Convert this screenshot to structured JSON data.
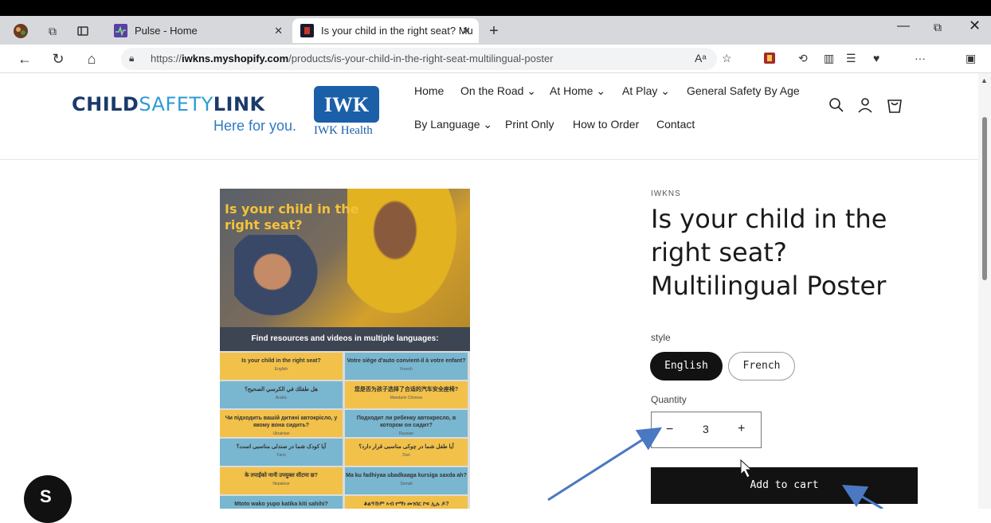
{
  "browser": {
    "tabs": [
      {
        "label": "Pulse - Home",
        "active": false
      },
      {
        "label": "Is your child in the right seat? Mu",
        "active": true
      }
    ],
    "url_prefix": "https://",
    "url_domain": "iwkns.myshopify.com",
    "url_path": "/products/is-your-child-in-the-right-seat-multilingual-poster",
    "new_tab": "+",
    "tab_close": "✕",
    "win_min": "—",
    "win_restore": "⧉",
    "win_close": "✕",
    "reader_label": "Aᵃ",
    "more_label": "···"
  },
  "site": {
    "logo_child": "CHILD",
    "logo_safety": "SAFETY",
    "logo_link": "LINK",
    "logo_tagline": "Here for you.",
    "logo_partner": "IWK Health",
    "nav": [
      {
        "label": "Home"
      },
      {
        "label": "On the Road ⌄"
      },
      {
        "label": "At Home ⌄"
      },
      {
        "label": "At Play ⌄"
      },
      {
        "label": "General Safety By Age"
      },
      {
        "label": "By Language ⌄"
      },
      {
        "label": "Print Only"
      },
      {
        "label": "How to Order"
      },
      {
        "label": "Contact"
      }
    ],
    "icons": [
      "search-icon",
      "account-icon",
      "cart-icon"
    ]
  },
  "poster": {
    "title": "Is your child in the right seat?",
    "band": "Find resources and videos in multiple languages:",
    "cells": [
      {
        "text": "Is your child in the right seat?",
        "sub": "English",
        "color": "y"
      },
      {
        "text": "Votre siège d'auto convient-il à votre enfant?",
        "sub": "French",
        "color": "b"
      },
      {
        "text": "هل طفلك في الكرسي الصحيح؟",
        "sub": "Arabic",
        "color": "b"
      },
      {
        "text": "您是否为孩子选择了合适的汽车安全座椅?",
        "sub": "Mandarin Chinese",
        "color": "y"
      },
      {
        "text": "Чи підходить вашій дитині автокрісло, у якому вона сидить?",
        "sub": "Ukrainian",
        "color": "y"
      },
      {
        "text": "Подходит ли ребенку автокресло, в котором он сидит?",
        "sub": "Russian",
        "color": "b"
      },
      {
        "text": "آیا کودک شما در صندلی مناسبی است؟",
        "sub": "Farsi",
        "color": "b"
      },
      {
        "text": "آیا طفل شما در چوکی مناسبی قرار دارد؟",
        "sub": "Dari",
        "color": "y"
      },
      {
        "text": "के तपाईंको नानी उपयुक्त सीटमा छ?",
        "sub": "Nepalese",
        "color": "y"
      },
      {
        "text": "Ma ku fadhiyaa ubadkaaga kursiga saxda ah?",
        "sub": "Somali",
        "color": "b"
      },
      {
        "text": "Mtoto wako yupo katika kiti sahihi?",
        "sub": "",
        "color": "b"
      },
      {
        "text": "ቆልዓኹም ኣብ የማነ መንበር ኮፍ ኢሉ ዶ?",
        "sub": "",
        "color": "y"
      }
    ]
  },
  "product": {
    "vendor": "IWKNS",
    "title": "Is your child in the right seat? Multilingual Poster",
    "style_label": "style",
    "styles": [
      {
        "label": "English",
        "selected": true
      },
      {
        "label": "French",
        "selected": false
      }
    ],
    "quantity_label": "Quantity",
    "quantity": "3",
    "minus": "−",
    "plus": "+",
    "add_to_cart": "Add to cart"
  },
  "shopify_badge": "S",
  "colors": {
    "brand_dark": "#1a3a6b",
    "brand_light": "#2e9bd6",
    "button": "#121212",
    "annotation_arrow": "#4a78c2"
  }
}
